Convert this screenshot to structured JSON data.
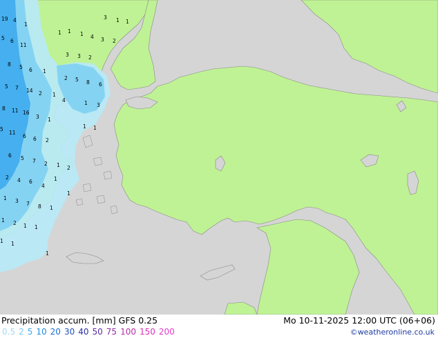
{
  "footer": {
    "title": "Precipitation accum. [mm]  GFS 0.25",
    "datetime": "Mo 10-11-2025 12:00 UTC (06+06)",
    "credit": "©weatheronline.co.uk"
  },
  "legend": {
    "values": [
      {
        "label": "0.5",
        "color": "#a4d9f3"
      },
      {
        "label": "2",
        "color": "#7cc8f0"
      },
      {
        "label": "5",
        "color": "#3fa9ef"
      },
      {
        "label": "10",
        "color": "#1c8fe3"
      },
      {
        "label": "20",
        "color": "#1a6fd6"
      },
      {
        "label": "30",
        "color": "#1f4fbf"
      },
      {
        "label": "40",
        "color": "#2b2fa8"
      },
      {
        "label": "50",
        "color": "#5a2aa3"
      },
      {
        "label": "75",
        "color": "#8e2aa0"
      },
      {
        "label": "100",
        "color": "#b72ba6"
      },
      {
        "label": "150",
        "color": "#d42fb7"
      },
      {
        "label": "200",
        "color": "#e23ccb"
      }
    ]
  },
  "colors": {
    "sea": "#d5d5d5",
    "land": "#bff294",
    "coast": "#888888",
    "precip_light": "#b7e9f7",
    "precip_mid": "#7fd0f2",
    "precip_heavy": "#3aa8ee"
  },
  "labels": [
    "19",
    "4",
    "1",
    "3",
    "1",
    "1",
    "1",
    "1",
    "1",
    "4",
    "3",
    "2",
    "5",
    "6",
    "11",
    "3",
    "3",
    "2",
    "8",
    "5",
    "6",
    "1",
    "2",
    "5",
    "8",
    "6",
    "5",
    "7",
    "14",
    "2",
    "1",
    "4",
    "1",
    "3",
    "8",
    "11",
    "16",
    "3",
    "1",
    "1",
    "5",
    "11",
    "6",
    "1",
    "6",
    "2",
    "6",
    "5",
    "7",
    "2",
    "1",
    "2",
    "2",
    "4",
    "6",
    "1",
    "4",
    "1",
    "1",
    "3",
    "7",
    "8",
    "1",
    "1",
    "2",
    "1",
    "1",
    "1",
    "1",
    "1"
  ]
}
